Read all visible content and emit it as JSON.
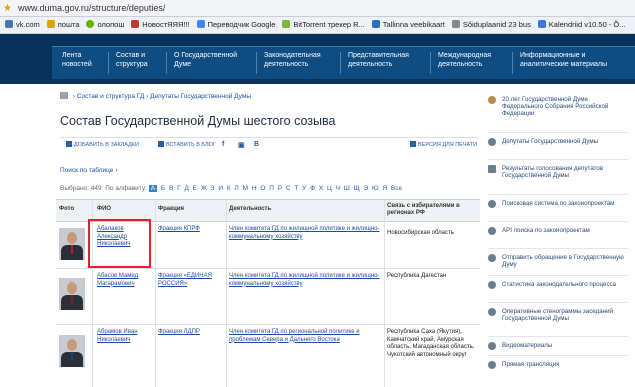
{
  "browser": {
    "url": "www.duma.gov.ru/structure/deputies/",
    "bookmarks": [
      "vk.com",
      "пошта",
      "олопош",
      "НовостЯЯЯ!!!",
      "Переводчик Google",
      "BitTorrent трекер R...",
      "Tallinna veebikaart",
      "Sõiduplaanid 23 bus",
      "Kalendriid v10.50 - Õ..."
    ]
  },
  "nav": [
    {
      "label": "Лента новостей"
    },
    {
      "label": "Состав и структура"
    },
    {
      "label": "О Государственной Думе"
    },
    {
      "label": "Законодательная деятельность"
    },
    {
      "label": "Представительная деятельность"
    },
    {
      "label": "Международная деятельность"
    },
    {
      "label": "Информационные и аналитические материалы"
    }
  ],
  "breadcrumb": {
    "part1": "Состав и структура ГД",
    "part2": "Депутаты Государственной Думы"
  },
  "page_title": "Состав Государственной Думы шестого созыва",
  "toolbar": {
    "bookmarks": "ДОБАВИТЬ В ЗАКЛАДКИ",
    "blog": "ВСТАВИТЬ В БЛОГ",
    "print": "ВЕРСИЯ ДЛЯ ПЕЧАТИ"
  },
  "search": {
    "label": "Поиск по таблице"
  },
  "alphabet": {
    "count_label": "Выбрано: 449",
    "by_label": "По алфавиту:",
    "selected": "А",
    "letters": [
      "Б",
      "В",
      "Г",
      "Д",
      "Е",
      "Ж",
      "З",
      "И",
      "К",
      "Л",
      "М",
      "Н",
      "О",
      "П",
      "Р",
      "С",
      "Т",
      "У",
      "Ф",
      "Х",
      "Ц",
      "Ч",
      "Ш",
      "Щ",
      "Э",
      "Ю",
      "Я"
    ],
    "all": "Все"
  },
  "table": {
    "headers": {
      "photo": "Фото",
      "name": "ФИО",
      "faction": "Фракция",
      "activity": "Деятельность",
      "region": "Связь с избирателями в регионах РФ"
    },
    "rows": [
      {
        "name": "Абалаков Александр Николаевич",
        "faction": "Фракция КПРФ",
        "activity": "Член комитета ГД по жилищной политике и жилищно-коммунальному хозяйству",
        "region": "Новосибирская область"
      },
      {
        "name": "Абасов Мамед Магарамович",
        "faction": "Фракция «ЕДИНАЯ РОССИЯ»",
        "activity": "Член комитета ГД по жилищной политике и жилищно-коммунальному хозяйству",
        "region": "Республика Дагестан"
      },
      {
        "name": "Абрамов Иван Николаевич",
        "faction": "Фракция ЛДПР",
        "activity": "Член комитета ГД по региональной политике и проблемам Севера и Дальнего Востока",
        "region": "Республика Саха (Якутия), Камчатский край, Амурская область, Магаданская область, Чукотский автономный округ"
      }
    ]
  },
  "sidebar": [
    {
      "label": "20 лет Государственной Думе Федерального Собрания Российской Федерации"
    },
    {
      "label": "Депутаты Государственной Думы"
    },
    {
      "label": "Результаты голосования депутатов Государственной Думы"
    },
    {
      "label": "Поисковая система по законопроектам"
    },
    {
      "label": "API поиска по законопроектам"
    },
    {
      "label": "Отправить обращение в Государственную Думу"
    },
    {
      "label": "Статистика законодательного процесса"
    },
    {
      "label": "Оперативные стенограммы заседаний Государственной Думы"
    },
    {
      "label": "Видеоматериалы"
    },
    {
      "label": "Прямая трансляция"
    }
  ]
}
